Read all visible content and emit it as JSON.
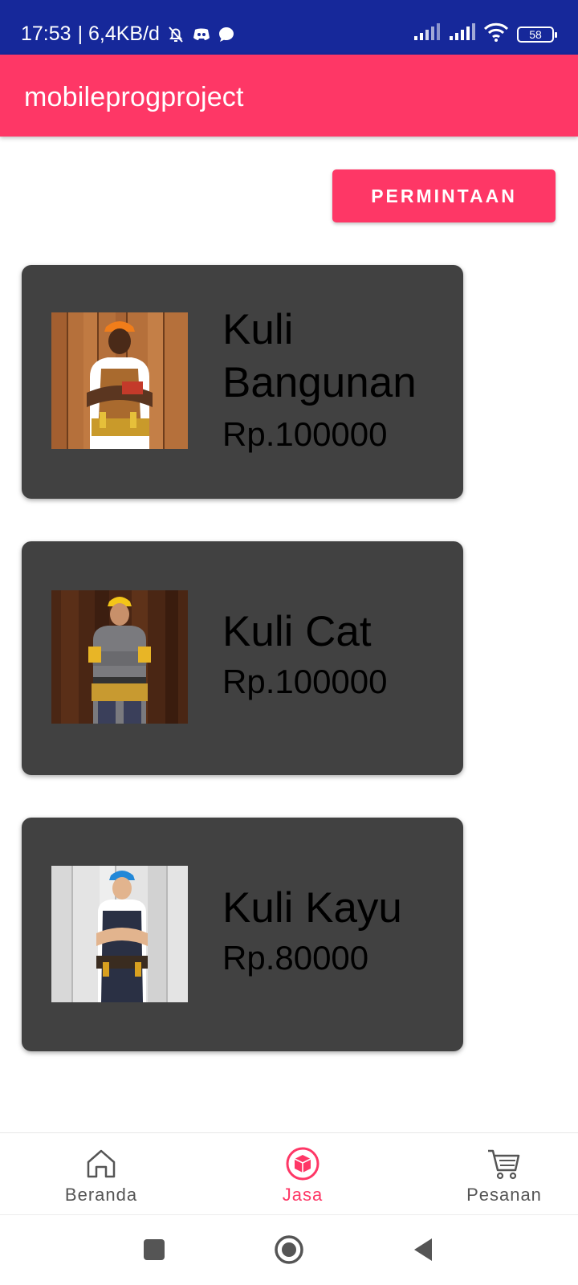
{
  "status_bar": {
    "time": "17:53",
    "network_speed": "| 6,4KB/d",
    "battery": "58",
    "icons": [
      "bell-off-icon",
      "discord-icon",
      "chat-bubble-icon",
      "signal-icon",
      "signal-icon",
      "wifi-icon",
      "battery-icon"
    ]
  },
  "app_bar": {
    "title": "mobileprogproject"
  },
  "actions": {
    "permintaan_label": "PERMINTAAN"
  },
  "services": [
    {
      "name": "Kuli Bangunan",
      "price": "Rp.100000"
    },
    {
      "name": "Kuli Cat",
      "price": "Rp.100000"
    },
    {
      "name": "Kuli Kayu",
      "price": "Rp.80000"
    }
  ],
  "bottom_nav": {
    "items": [
      {
        "label": "Beranda",
        "icon": "home-icon",
        "active": false
      },
      {
        "label": "Jasa",
        "icon": "box-icon",
        "active": true
      },
      {
        "label": "Pesanan",
        "icon": "cart-icon",
        "active": false
      }
    ]
  },
  "system_nav": {
    "icons": [
      "recents-square-icon",
      "home-circle-icon",
      "back-triangle-icon"
    ]
  },
  "colors": {
    "accent": "#fe3766",
    "status_bar": "#16289a",
    "card": "#414141"
  }
}
